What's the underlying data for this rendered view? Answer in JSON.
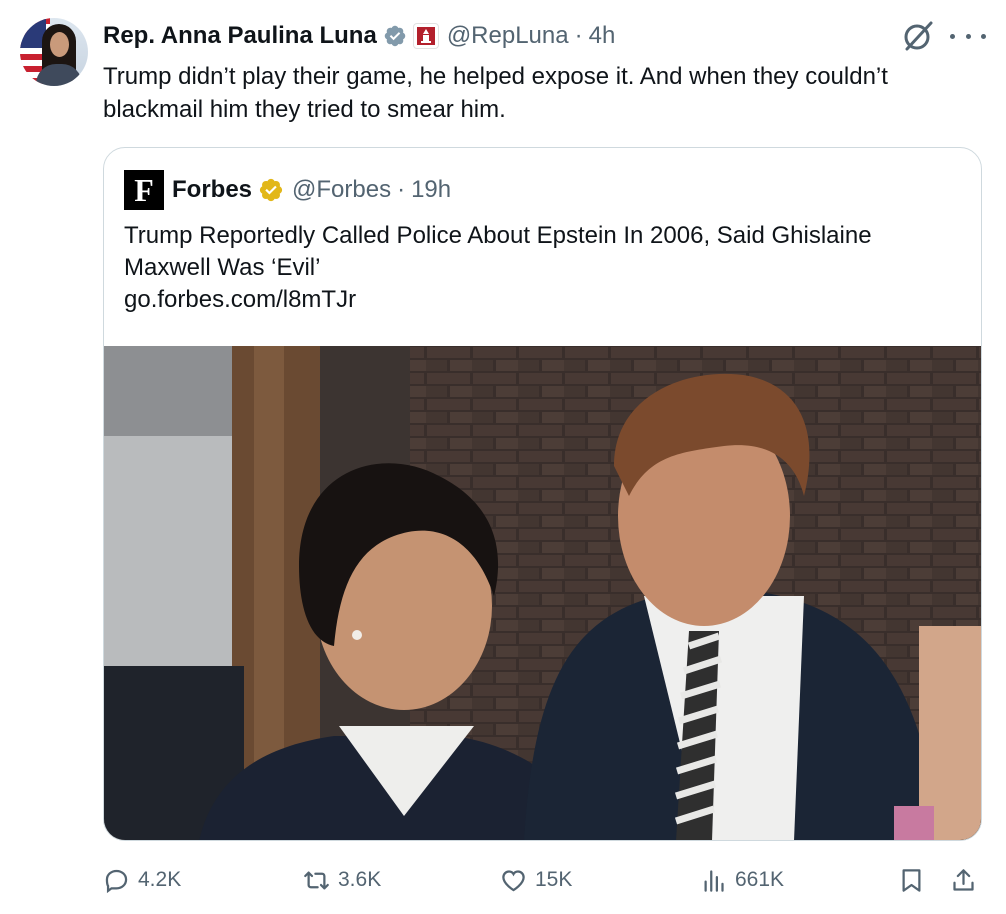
{
  "author": {
    "name": "Rep. Anna Paulina Luna",
    "handle": "@RepLuna",
    "time": "4h"
  },
  "tweet_text": "Trump didn’t play their game, he helped expose it. And when they couldn’t blackmail him they tried to smear him.",
  "quoted": {
    "logo_letter": "F",
    "name": "Forbes",
    "handle": "@Forbes",
    "time": "19h",
    "text": "Trump Reportedly Called Police About Epstein In 2006, Said Ghislaine Maxwell Was ‘Evil’",
    "link": "go.forbes.com/l8mTJr"
  },
  "actions": {
    "replies": "4.2K",
    "retweets": "3.6K",
    "likes": "15K",
    "views": "661K"
  },
  "icons": {
    "verified": "verified-badge-icon",
    "affiliation": "capitol-badge-icon",
    "grok": "grok-icon",
    "more": "more-icon",
    "reply": "reply-icon",
    "retweet": "retweet-icon",
    "like": "heart-icon",
    "views": "views-icon",
    "bookmark": "bookmark-icon",
    "share": "share-icon"
  },
  "colors": {
    "text": "#0f1419",
    "secondary": "#536471",
    "border": "#cfd9de",
    "verified_blue": "#1d9bf0",
    "verified_gray": "#829aab",
    "verified_gold": "#e2b719"
  }
}
